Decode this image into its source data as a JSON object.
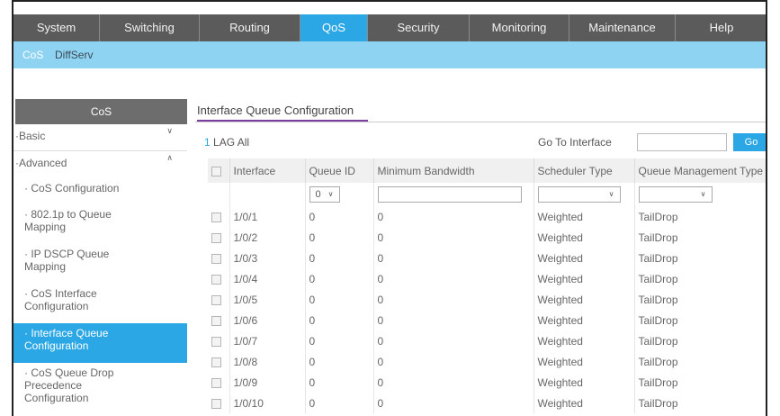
{
  "nav": {
    "items": [
      {
        "label": "System",
        "width": 96
      },
      {
        "label": "Switching",
        "width": 111
      },
      {
        "label": "Routing",
        "width": 112
      },
      {
        "label": "QoS",
        "width": 75
      },
      {
        "label": "Security",
        "width": 113
      },
      {
        "label": "Monitoring",
        "width": 111
      },
      {
        "label": "Maintenance",
        "width": 118
      },
      {
        "label": "Help",
        "width": 100
      }
    ],
    "active": "QoS"
  },
  "subnav": {
    "cos": "CoS",
    "diffserv": "DiffServ"
  },
  "sidebar": {
    "header": "CoS",
    "basic": "Basic",
    "advanced": "Advanced",
    "items": [
      {
        "label": "CoS Configuration"
      },
      {
        "label": "802.1p to Queue Mapping"
      },
      {
        "label": "IP DSCP Queue Mapping"
      },
      {
        "label": "CoS Interface Configuration"
      },
      {
        "label": "Interface Queue Configuration"
      },
      {
        "label": "CoS Queue Drop Precedence Configuration"
      }
    ]
  },
  "content": {
    "tab_title": "Interface Queue Configuration",
    "lag_num": "1",
    "lag_text": "LAG All",
    "goto_label": "Go To Interface",
    "go_button": "Go"
  },
  "table": {
    "headers": [
      "Interface",
      "Queue ID",
      "Minimum Bandwidth",
      "Scheduler Type",
      "Queue Management Type"
    ],
    "queue_filter": "0",
    "rows": [
      {
        "iface": "1/0/1",
        "qid": "0",
        "bw": "0",
        "sched": "Weighted",
        "qmgmt": "TailDrop"
      },
      {
        "iface": "1/0/2",
        "qid": "0",
        "bw": "0",
        "sched": "Weighted",
        "qmgmt": "TailDrop"
      },
      {
        "iface": "1/0/3",
        "qid": "0",
        "bw": "0",
        "sched": "Weighted",
        "qmgmt": "TailDrop"
      },
      {
        "iface": "1/0/4",
        "qid": "0",
        "bw": "0",
        "sched": "Weighted",
        "qmgmt": "TailDrop"
      },
      {
        "iface": "1/0/5",
        "qid": "0",
        "bw": "0",
        "sched": "Weighted",
        "qmgmt": "TailDrop"
      },
      {
        "iface": "1/0/6",
        "qid": "0",
        "bw": "0",
        "sched": "Weighted",
        "qmgmt": "TailDrop"
      },
      {
        "iface": "1/0/7",
        "qid": "0",
        "bw": "0",
        "sched": "Weighted",
        "qmgmt": "TailDrop"
      },
      {
        "iface": "1/0/8",
        "qid": "0",
        "bw": "0",
        "sched": "Weighted",
        "qmgmt": "TailDrop"
      },
      {
        "iface": "1/0/9",
        "qid": "0",
        "bw": "0",
        "sched": "Weighted",
        "qmgmt": "TailDrop"
      },
      {
        "iface": "1/0/10",
        "qid": "0",
        "bw": "0",
        "sched": "Weighted",
        "qmgmt": "TailDrop"
      }
    ]
  },
  "colors": {
    "accent": "#2aa7e4",
    "nav_bg": "#5b5b5b",
    "subnav_bg": "#8fd3f2",
    "tab_underline": "#7b3fa0"
  }
}
